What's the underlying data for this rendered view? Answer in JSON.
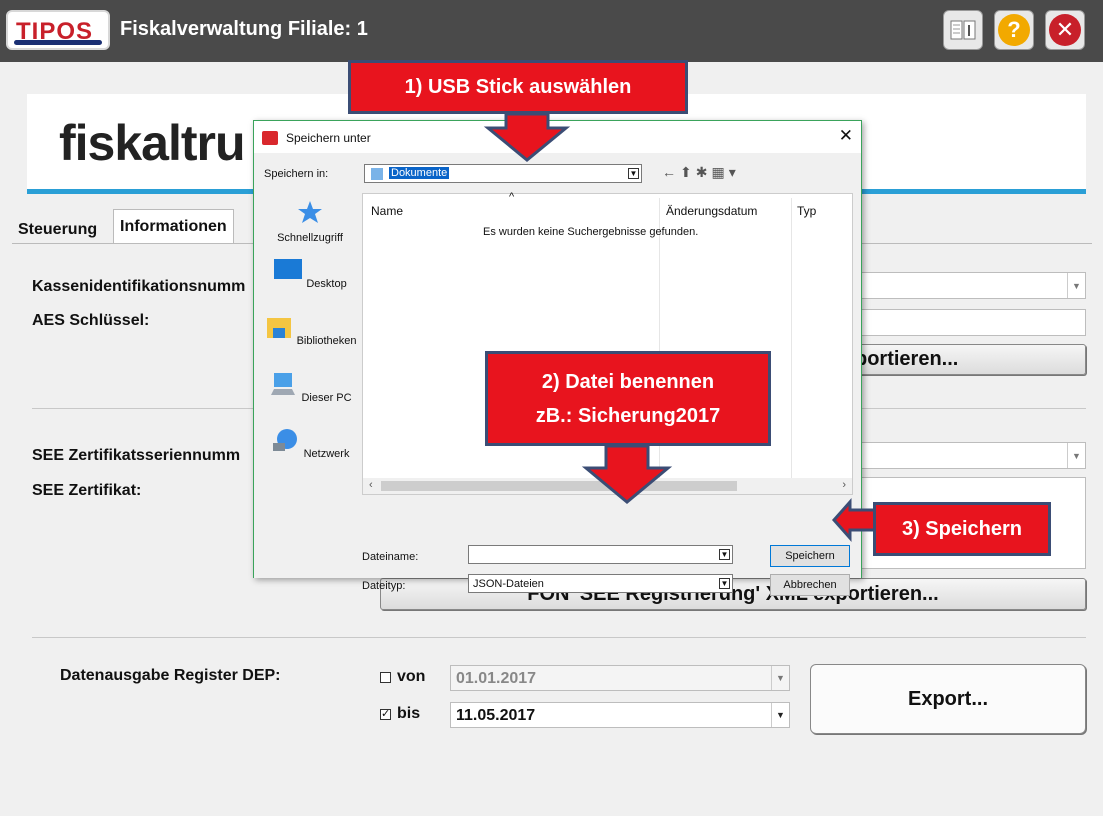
{
  "titlebar": {
    "logo_text": "TIPOS",
    "title": "Fiskalverwaltung Filiale: 1"
  },
  "brand": {
    "text": "fiskaltru"
  },
  "tabs": [
    {
      "label": "Steuerung"
    },
    {
      "label": "Informationen"
    }
  ],
  "form": {
    "kassen_label": "Kassenidentifikationsnumm",
    "aes_label": "AES Schlüssel:",
    "export_partial_label": "portieren...",
    "see_serial_label": "SEE Zertifikatsseriennumm",
    "see_cert_label": "SEE Zertifikat:",
    "fon_button": "FON 'SEE Registrierung' XML exportieren...",
    "dep_label": "Datenausgabe Register DEP:",
    "von_label": "von",
    "von_date": "01.01.2017",
    "von_checked": false,
    "bis_label": "bis",
    "bis_date": "11.05.2017",
    "bis_checked": true,
    "export_button": "Export..."
  },
  "dialog": {
    "title": "Speichern unter",
    "save_in_label": "Speichern in:",
    "save_in_value": "Dokumente",
    "places": [
      "Schnellzugriff",
      "Desktop",
      "Bibliotheken",
      "Dieser PC",
      "Netzwerk"
    ],
    "columns": [
      "Name",
      "Änderungsdatum",
      "Typ"
    ],
    "empty_message": "Es wurden keine Suchergebnisse gefunden.",
    "filename_label": "Dateiname:",
    "filename_value": "",
    "filetype_label": "Dateityp:",
    "filetype_value": "JSON-Dateien",
    "save_button": "Speichern",
    "cancel_button": "Abbrechen"
  },
  "callouts": {
    "step1": "1) USB Stick auswählen",
    "step2_line1": "2) Datei benennen",
    "step2_line2": "zB.: Sicherung2017",
    "step3": "3) Speichern"
  },
  "colors": {
    "titlebar": "#4a4a4a",
    "brand_line": "#2a9fd6",
    "callout_fill": "#e8141e",
    "callout_border": "#3b4d75",
    "dialog_border": "#3aa35b"
  }
}
